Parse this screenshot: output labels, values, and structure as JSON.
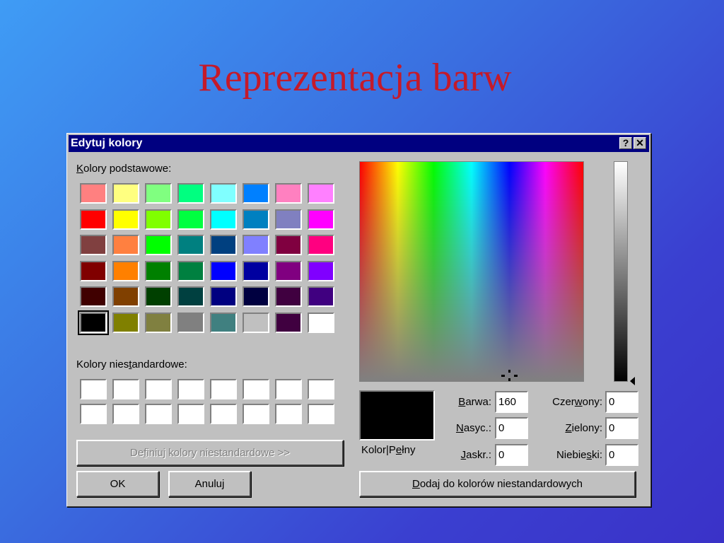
{
  "slide": {
    "title": "Reprezentacja barw"
  },
  "dialog": {
    "title": "Edytuj kolory",
    "help_label": "?",
    "close_label": "✕",
    "basic_label_first": "K",
    "basic_label_rest": "olory podstawowe:",
    "custom_label_pre": "Kolory nies",
    "custom_label_ul": "t",
    "custom_label_post": "andardowe:",
    "basic_colors": [
      [
        "#ff8080",
        "#ffff80",
        "#80ff80",
        "#00ff80",
        "#80ffff",
        "#0080ff",
        "#ff80c0",
        "#ff80ff"
      ],
      [
        "#ff0000",
        "#ffff00",
        "#80ff00",
        "#00ff40",
        "#00ffff",
        "#0080c0",
        "#8080c0",
        "#ff00ff"
      ],
      [
        "#804040",
        "#ff8040",
        "#00ff00",
        "#008080",
        "#004080",
        "#8080ff",
        "#800040",
        "#ff0080"
      ],
      [
        "#800000",
        "#ff8000",
        "#008000",
        "#008040",
        "#0000ff",
        "#0000a0",
        "#800080",
        "#8000ff"
      ],
      [
        "#400000",
        "#804000",
        "#004000",
        "#004040",
        "#000080",
        "#000040",
        "#400040",
        "#400080"
      ],
      [
        "#000000",
        "#808000",
        "#808040",
        "#808080",
        "#408080",
        "#c0c0c0",
        "#400040",
        "#ffffff"
      ]
    ],
    "selected_basic": "#000000",
    "custom_colors": [
      [
        "#ffffff",
        "#ffffff",
        "#ffffff",
        "#ffffff",
        "#ffffff",
        "#ffffff",
        "#ffffff",
        "#ffffff"
      ],
      [
        "#ffffff",
        "#ffffff",
        "#ffffff",
        "#ffffff",
        "#ffffff",
        "#ffffff",
        "#ffffff",
        "#ffffff"
      ]
    ],
    "define_button": {
      "pre": "De",
      "ul": "f",
      "post": "iniuj kolory niestandardowe >>"
    },
    "ok_label": "OK",
    "cancel_label": "Anuluj",
    "preview_color": "#000000",
    "preview_label_pre": "Kolor|P",
    "preview_label_ul": "e",
    "preview_label_post": "łny",
    "hue": {
      "ul": "B",
      "rest": "arwa:",
      "value": "160"
    },
    "sat": {
      "ul": "N",
      "rest": "asyc.:",
      "value": "0"
    },
    "lum": {
      "ul": "J",
      "rest": "askr.:",
      "value": "0"
    },
    "red": {
      "pre": "Czer",
      "ul": "w",
      "post": "ony:",
      "value": "0"
    },
    "green": {
      "ul": "Z",
      "rest": "ielony:",
      "value": "0"
    },
    "blue": {
      "pre": "Niebie",
      "ul": "s",
      "post": "ki:",
      "value": "0"
    },
    "add_button": {
      "ul": "D",
      "rest": "odaj do kolorów niestandardowych"
    }
  }
}
